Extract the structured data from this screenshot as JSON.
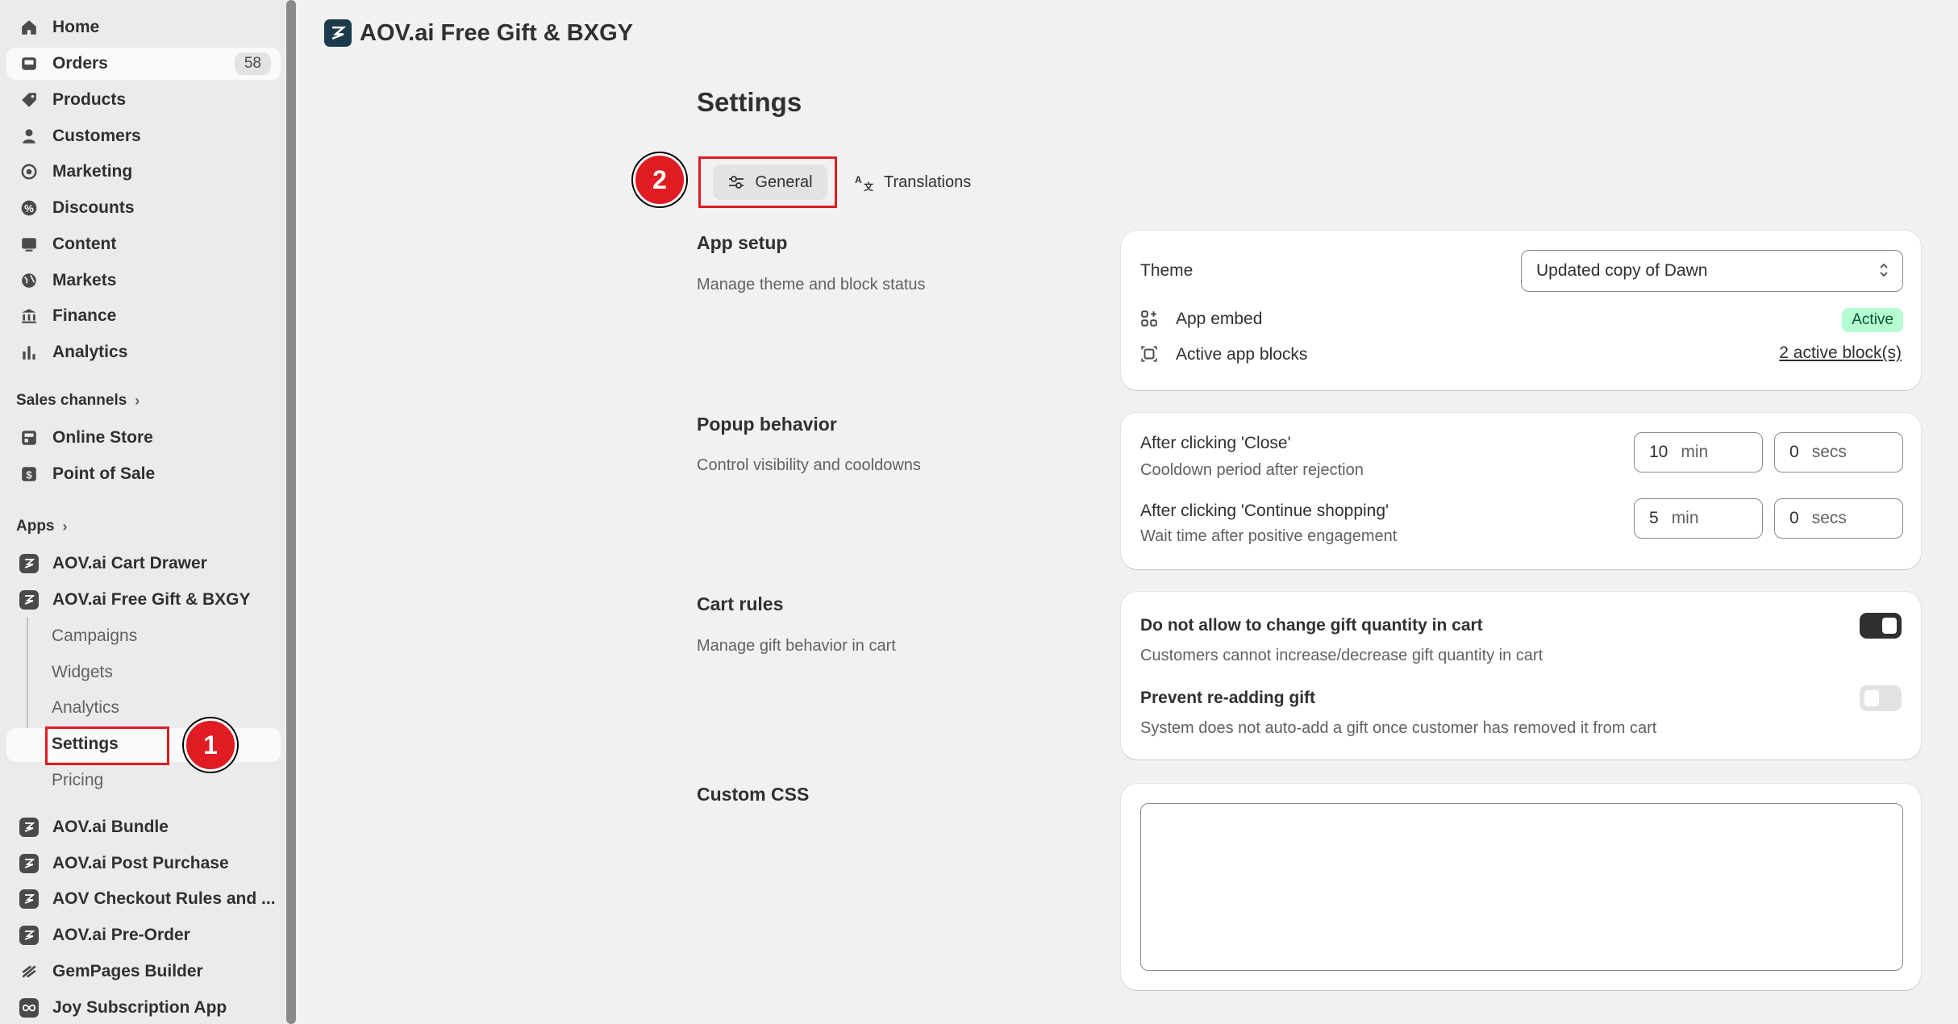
{
  "sidebar": {
    "items": [
      {
        "label": "Home",
        "icon": "home-icon"
      },
      {
        "label": "Orders",
        "icon": "orders-icon",
        "count": "58"
      },
      {
        "label": "Products",
        "icon": "tag-icon"
      },
      {
        "label": "Customers",
        "icon": "person-icon"
      },
      {
        "label": "Marketing",
        "icon": "target-icon"
      },
      {
        "label": "Discounts",
        "icon": "discount-icon"
      },
      {
        "label": "Content",
        "icon": "content-icon"
      },
      {
        "label": "Markets",
        "icon": "globe-icon"
      },
      {
        "label": "Finance",
        "icon": "bank-icon"
      },
      {
        "label": "Analytics",
        "icon": "bar-chart-icon"
      }
    ],
    "sales_channels_title": "Sales channels",
    "sales_channels": [
      {
        "label": "Online Store"
      },
      {
        "label": "Point of Sale"
      }
    ],
    "apps_title": "Apps",
    "apps": [
      {
        "label": "AOV.ai Cart Drawer"
      },
      {
        "label": "AOV.ai Free Gift & BXGY"
      }
    ],
    "app_subitems": [
      "Campaigns",
      "Widgets",
      "Analytics",
      "Settings",
      "Pricing"
    ],
    "more_apps": [
      {
        "label": "AOV.ai Bundle"
      },
      {
        "label": "AOV.ai Post Purchase"
      },
      {
        "label": "AOV Checkout Rules and ..."
      },
      {
        "label": "AOV.ai Pre-Order"
      },
      {
        "label": "GemPages Builder"
      },
      {
        "label": "Joy Subscription App"
      }
    ]
  },
  "header": {
    "title": "AOV.ai Free Gift & BXGY"
  },
  "page": {
    "title": "Settings"
  },
  "tabs": [
    {
      "label": "General"
    },
    {
      "label": "Translations"
    }
  ],
  "annotations": {
    "step1": "1",
    "step2": "2"
  },
  "app_setup": {
    "title": "App setup",
    "desc": "Manage theme and block status",
    "theme_label": "Theme",
    "theme_value": "Updated copy of Dawn",
    "app_embed_label": "App embed",
    "app_embed_status": "Active",
    "blocks_label": "Active app blocks",
    "blocks_link": "2 active block(s)"
  },
  "popup": {
    "title": "Popup behavior",
    "desc": "Control visibility and cooldowns",
    "close_label": "After clicking 'Close'",
    "close_sub": "Cooldown period after rejection",
    "close_min": "10",
    "close_secs": "0",
    "continue_label": "After clicking 'Continue shopping'",
    "continue_sub": "Wait time after positive engagement",
    "continue_min": "5",
    "continue_secs": "0",
    "unit_min": "min",
    "unit_secs": "secs"
  },
  "cart_rules": {
    "title": "Cart rules",
    "desc": "Manage gift behavior in cart",
    "rule1_label": "Do not allow to change gift quantity in cart",
    "rule1_sub": "Customers cannot increase/decrease gift quantity in cart",
    "rule1_on": true,
    "rule2_label": "Prevent re-adding gift",
    "rule2_sub": "System does not auto-add a gift once customer has removed it from cart",
    "rule2_on": false
  },
  "custom_css": {
    "title": "Custom CSS",
    "value": ""
  },
  "colors": {
    "annotation_red": "#e01b22",
    "active_badge": "#b4fed2"
  }
}
